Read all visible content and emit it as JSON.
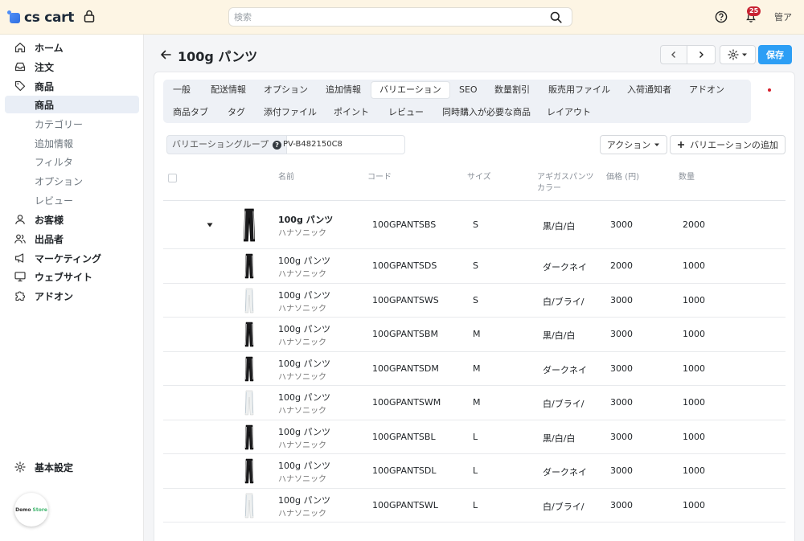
{
  "header": {
    "logo_text": "cs cart",
    "search_placeholder": "検索",
    "notification_count": "25",
    "user": "管ア"
  },
  "sidebar": {
    "items": [
      {
        "label": "ホーム",
        "icon": "home-icon"
      },
      {
        "label": "注文",
        "icon": "inbox-icon"
      },
      {
        "label": "商品",
        "icon": "tag-icon"
      },
      {
        "label": "商品",
        "active": true
      },
      {
        "label": "カテゴリー"
      },
      {
        "label": "追加情報"
      },
      {
        "label": "フィルタ"
      },
      {
        "label": "オプション"
      },
      {
        "label": "レビュー"
      },
      {
        "label": "お客様",
        "icon": "user-icon"
      },
      {
        "label": "出品者",
        "icon": "users-icon"
      },
      {
        "label": "マーケティング",
        "icon": "megaphone-icon"
      },
      {
        "label": "ウェブサイト",
        "icon": "monitor-icon"
      },
      {
        "label": "アドオン",
        "icon": "puzzle-icon"
      }
    ],
    "settings_label": "基本設定",
    "demo_store": {
      "left": "Demo",
      "right": "Store"
    }
  },
  "page": {
    "title": "100g パンツ",
    "save_label": "保存"
  },
  "tabs_row1": [
    "一般",
    "配送情報",
    "オプション",
    "追加情報",
    "バリエーション",
    "SEO",
    "数量割引",
    "販売用ファイル",
    "入荷通知者",
    "アドオン"
  ],
  "tabs_row2": [
    "商品タブ",
    "タグ",
    "添付ファイル",
    "ポイント",
    "レビュー",
    "同時購入が必要な商品",
    "レイアウト"
  ],
  "active_tab": "バリエーション",
  "variation_group": {
    "label": "バリエーショングループ",
    "help": "?",
    "value": "PV-B482150C8"
  },
  "actions": {
    "action_label": "アクション",
    "add_label": "バリエーションの追加"
  },
  "table": {
    "columns": [
      "名前",
      "コード",
      "サイズ",
      "アギガスパンツ\nカラー",
      "価格 (円)",
      "数量"
    ],
    "rows": [
      {
        "name": "100g パンツ",
        "brand": "ハナソニック",
        "code": "100GPANTSBS",
        "size": "S",
        "color": "黒/白/白",
        "price": "3000",
        "qty": "2000",
        "main": true,
        "swatch": "black"
      },
      {
        "name": "100g パンツ",
        "brand": "ハナソニック",
        "code": "100GPANTSDS",
        "size": "S",
        "color": "ダークネイ",
        "price": "2000",
        "qty": "1000",
        "swatch": "black"
      },
      {
        "name": "100g パンツ",
        "brand": "ハナソニック",
        "code": "100GPANTSWS",
        "size": "S",
        "color": "白/ブライ/",
        "price": "3000",
        "qty": "1000",
        "swatch": "white"
      },
      {
        "name": "100g パンツ",
        "brand": "ハナソニック",
        "code": "100GPANTSBM",
        "size": "M",
        "color": "黒/白/白",
        "price": "3000",
        "qty": "1000",
        "swatch": "black"
      },
      {
        "name": "100g パンツ",
        "brand": "ハナソニック",
        "code": "100GPANTSDM",
        "size": "M",
        "color": "ダークネイ",
        "price": "3000",
        "qty": "1000",
        "swatch": "black"
      },
      {
        "name": "100g パンツ",
        "brand": "ハナソニック",
        "code": "100GPANTSWM",
        "size": "M",
        "color": "白/ブライ/",
        "price": "3000",
        "qty": "1000",
        "swatch": "white"
      },
      {
        "name": "100g パンツ",
        "brand": "ハナソニック",
        "code": "100GPANTSBL",
        "size": "L",
        "color": "黒/白/白",
        "price": "3000",
        "qty": "1000",
        "swatch": "black"
      },
      {
        "name": "100g パンツ",
        "brand": "ハナソニック",
        "code": "100GPANTSDL",
        "size": "L",
        "color": "ダークネイ",
        "price": "3000",
        "qty": "1000",
        "swatch": "black"
      },
      {
        "name": "100g パンツ",
        "brand": "ハナソニック",
        "code": "100GPANTSWL",
        "size": "L",
        "color": "白/ブライ/",
        "price": "3000",
        "qty": "1000",
        "swatch": "white"
      }
    ]
  },
  "colors": {
    "accent": "#2c9ef5",
    "header_bg": "#fdf5e4",
    "badge": "#c82333"
  }
}
